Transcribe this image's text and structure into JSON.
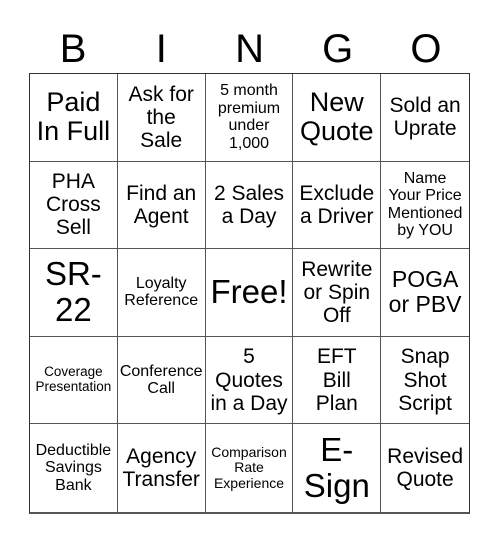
{
  "card": {
    "header_letters": [
      "B",
      "I",
      "N",
      "G",
      "O"
    ],
    "rows": [
      [
        {
          "text": "Paid\nIn Full",
          "size": "s-lg"
        },
        {
          "text": "Ask for\nthe\nSale",
          "size": "s-md"
        },
        {
          "text": "5 month\npremium\nunder\n1,000",
          "size": "s-xs"
        },
        {
          "text": "New\nQuote",
          "size": "s-lg"
        },
        {
          "text": "Sold an\nUprate",
          "size": "s-md"
        }
      ],
      [
        {
          "text": "PHA\nCross\nSell",
          "size": "s-md"
        },
        {
          "text": "Find an\nAgent",
          "size": "s-md"
        },
        {
          "text": "2 Sales\na Day",
          "size": "s-md"
        },
        {
          "text": "Exclude\na Driver",
          "size": "s-md"
        },
        {
          "text": "Name\nYour Price\nMentioned\nby YOU",
          "size": "s-xs"
        }
      ],
      [
        {
          "text": "SR-\n22",
          "size": "s-xl"
        },
        {
          "text": "Loyalty\nReference",
          "size": "s-xs"
        },
        {
          "text": "Free!",
          "size": "s-xl"
        },
        {
          "text": "Rewrite\nor Spin\nOff",
          "size": "s-md"
        },
        {
          "text": "POGA\nor PBV",
          "size": "s-ml"
        }
      ],
      [
        {
          "text": "Coverage\nPresentation",
          "size": "s-tiny"
        },
        {
          "text": "Conference\nCall",
          "size": "s-xs"
        },
        {
          "text": "5\nQuotes\nin a Day",
          "size": "s-md"
        },
        {
          "text": "EFT\nBill\nPlan",
          "size": "s-md"
        },
        {
          "text": "Snap\nShot\nScript",
          "size": "s-md"
        }
      ],
      [
        {
          "text": "Deductible\nSavings\nBank",
          "size": "s-xs"
        },
        {
          "text": "Agency\nTransfer",
          "size": "s-md"
        },
        {
          "text": "Comparison\nRate\nExperience",
          "size": "s-xxs"
        },
        {
          "text": "E-\nSign",
          "size": "s-xl"
        },
        {
          "text": "Revised\nQuote",
          "size": "s-md"
        }
      ]
    ]
  }
}
